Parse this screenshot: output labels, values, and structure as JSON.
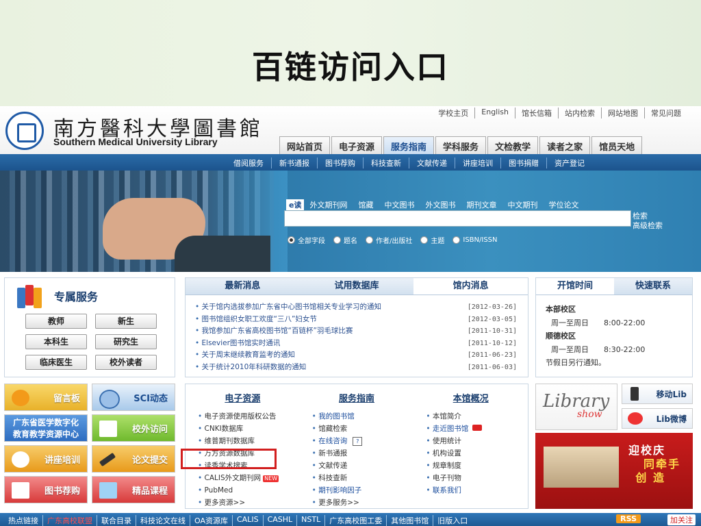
{
  "slide": {
    "title": "百链访问入口"
  },
  "header": {
    "logo_cn": "南方醫科大學圖書館",
    "logo_en": "Southern Medical University Library",
    "top_links": [
      "学校主页",
      "English",
      "馆长信箱",
      "站内检索",
      "网站地图",
      "常见问题"
    ],
    "nav_tabs": [
      "网站首页",
      "电子资源",
      "服务指南",
      "学科服务",
      "文检教学",
      "读者之家",
      "馆员天地"
    ],
    "nav_active": "服务指南",
    "sub_nav": [
      "借阅服务",
      "新书通报",
      "图书荐购",
      "科技查新",
      "文献传递",
      "讲座培训",
      "图书捐赠",
      "资产登记"
    ]
  },
  "search": {
    "etab": "e读",
    "tabs": [
      "外文期刊网",
      "馆藏",
      "中文图书",
      "外文图书",
      "期刊文章",
      "中文期刊",
      "学位论文"
    ],
    "search_link": "检索",
    "advanced_link": "高级检索",
    "radios": [
      "全部字段",
      "题名",
      "作者/出版社",
      "主题",
      "ISBN/ISSN"
    ],
    "radio_selected": "全部字段"
  },
  "service": {
    "title": "专属服务",
    "buttons": [
      "教师",
      "新生",
      "本科生",
      "研究生",
      "临床医生",
      "校外读者"
    ]
  },
  "news": {
    "tabs": [
      "最新消息",
      "试用数据库",
      "馆内消息"
    ],
    "active": "馆内消息",
    "items": [
      {
        "title": "关于馆内选拔参加广东省中心图书馆相关专业学习的通知",
        "date": "[2012-03-26]"
      },
      {
        "title": "图书馆组织女职工欢度“三八”妇女节",
        "date": "[2012-03-05]"
      },
      {
        "title": "我馆参加广东省高校图书馆“百链杯”羽毛球比赛",
        "date": "[2011-10-31]"
      },
      {
        "title": "Elsevier图书馆实时通讯",
        "date": "[2011-10-12]"
      },
      {
        "title": "关于周末继续教育监考的通知",
        "date": "[2011-06-23]"
      },
      {
        "title": "关于统计2010年科研数据的通知",
        "date": "[2011-06-03]"
      }
    ]
  },
  "hours": {
    "tabs": [
      "开馆时间",
      "快速联系"
    ],
    "campus1": "本部校区",
    "days1": "周一至周日",
    "time1": "8:00-22:00",
    "campus2": "顺德校区",
    "days2": "周一至周日",
    "time2": "8:30-22:00",
    "note": "节假日另行通知。"
  },
  "tiles": {
    "message": "留言板",
    "sci": "SCI动态",
    "gd_line1": "广东省医学数字化",
    "gd_line2": "教育教学资源中心",
    "offcampus": "校外访问",
    "training": "讲座培训",
    "thesis": "论文提交",
    "purchase": "图书荐购",
    "courses": "精品课程"
  },
  "resources": {
    "col1_head": "电子资源",
    "col1": [
      "电子资源使用版权公告",
      "CNKI数据库",
      "维普期刊数据库",
      "万方资源数据库",
      "读秀学术搜索",
      "CALIS外文期刊网",
      "PubMed",
      "更多资源>>"
    ],
    "col2_head": "服务指南",
    "col2": [
      "我的图书馆",
      "馆藏检索",
      "在线咨询",
      "新书通报",
      "文献传递",
      "科技查新",
      "期刊影响因子",
      "更多服务>>"
    ],
    "col3_head": "本馆概况",
    "col3": [
      "本馆简介",
      "走近图书馆",
      "使用统计",
      "机构设置",
      "规章制度",
      "电子刊物",
      "联系我们"
    ],
    "new_badge": "NEW",
    "help_badge": "?"
  },
  "side": {
    "lib_show_1": "Library",
    "lib_show_2": "show",
    "mobile": "移动Lib",
    "weibo": "Lib微博",
    "anniv1": "迎校庆",
    "anniv2": "同牵手",
    "anniv3": "创 造"
  },
  "footer": {
    "links": [
      "热点链接",
      "广东高校联盟",
      "联合目录",
      "科技论文在线",
      "OA资源库",
      "CALIS",
      "CASHL",
      "NSTL",
      "广东高校图工委",
      "其他图书馆",
      "旧版入口"
    ],
    "rss": "RSS",
    "follow": "加关注"
  },
  "colors": {
    "brand_blue": "#1f5aa6",
    "highlight_red": "#d21f1f"
  }
}
